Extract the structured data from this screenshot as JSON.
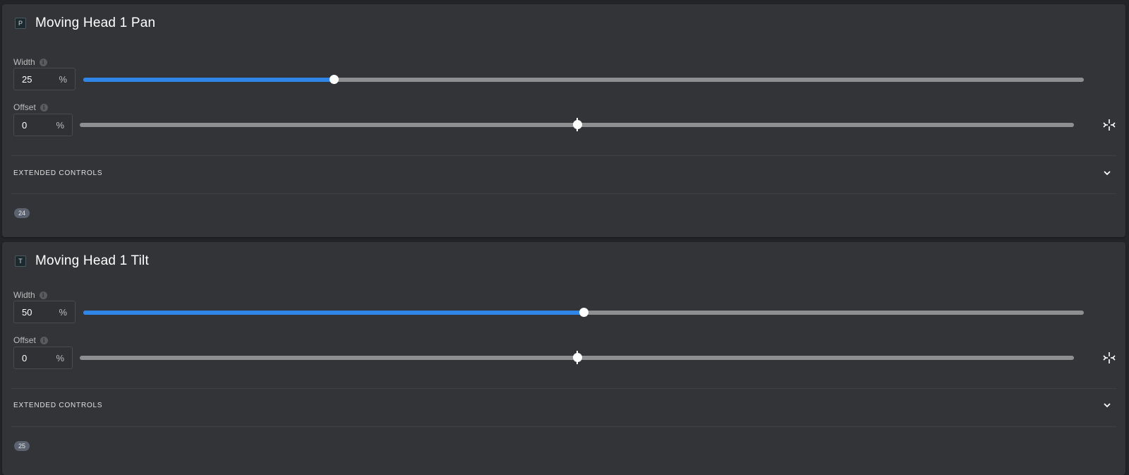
{
  "panels": [
    {
      "badge_letter": "P",
      "title": "Moving Head 1 Pan",
      "width": {
        "label": "Width",
        "value": "25",
        "unit": "%",
        "fraction": 0.25
      },
      "offset": {
        "label": "Offset",
        "value": "0",
        "unit": "%",
        "fraction": 0.5
      },
      "extended_label": "EXTENDED CONTROLS",
      "channel": "24"
    },
    {
      "badge_letter": "T",
      "title": "Moving Head 1 Tilt",
      "width": {
        "label": "Width",
        "value": "50",
        "unit": "%",
        "fraction": 0.5
      },
      "offset": {
        "label": "Offset",
        "value": "0",
        "unit": "%",
        "fraction": 0.5
      },
      "extended_label": "EXTENDED CONTROLS",
      "channel": "25"
    }
  ],
  "icons": {
    "info": "info-icon",
    "center": "center-icon",
    "chevron": "chevron-down-icon"
  },
  "colors": {
    "accent": "#2f86e6",
    "panel_bg": "#333437",
    "track": "#8e8f91"
  }
}
